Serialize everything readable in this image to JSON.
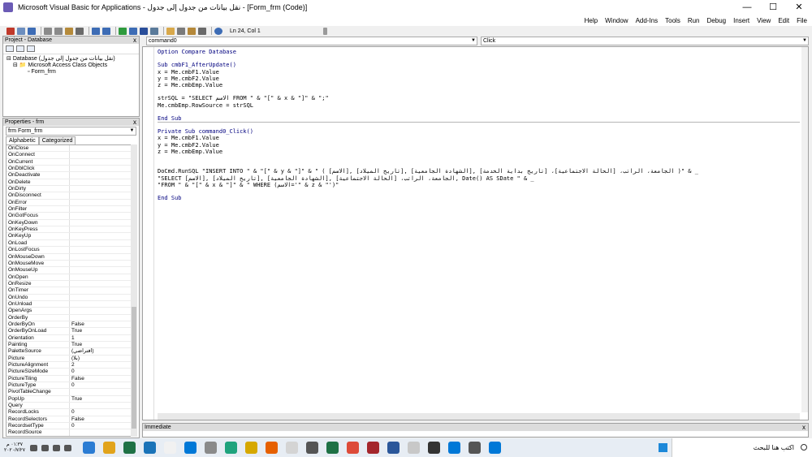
{
  "window": {
    "title": "Microsoft Visual Basic for Applications - نقل بيانات من جدول إلى جدول - [Form_frm (Code)]",
    "minimize": "—",
    "maximize": "☐",
    "close": "✕"
  },
  "menu": [
    "Help",
    "Window",
    "Add-Ins",
    "Tools",
    "Run",
    "Debug",
    "Insert",
    "View",
    "Edit",
    "File"
  ],
  "toolbar": {
    "cursor_position": "Ln 24, Col 1"
  },
  "project": {
    "title": "Project - Database",
    "close": "x",
    "root": "Database (نقل بيانات من جدول إلى جدول)",
    "folder": "Microsoft Access Class Objects",
    "item": "Form_frm"
  },
  "properties": {
    "title": "Properties - frm",
    "close": "x",
    "object": "frm Form_frm",
    "tabs": [
      "Alphabetic",
      "Categorized"
    ],
    "rows": [
      {
        "k": "OnClose",
        "v": ""
      },
      {
        "k": "OnConnect",
        "v": ""
      },
      {
        "k": "OnCurrent",
        "v": ""
      },
      {
        "k": "OnDblClick",
        "v": ""
      },
      {
        "k": "OnDeactivate",
        "v": ""
      },
      {
        "k": "OnDelete",
        "v": ""
      },
      {
        "k": "OnDirty",
        "v": ""
      },
      {
        "k": "OnDisconnect",
        "v": ""
      },
      {
        "k": "OnError",
        "v": ""
      },
      {
        "k": "OnFilter",
        "v": ""
      },
      {
        "k": "OnGotFocus",
        "v": ""
      },
      {
        "k": "OnKeyDown",
        "v": ""
      },
      {
        "k": "OnKeyPress",
        "v": ""
      },
      {
        "k": "OnKeyUp",
        "v": ""
      },
      {
        "k": "OnLoad",
        "v": ""
      },
      {
        "k": "OnLostFocus",
        "v": ""
      },
      {
        "k": "OnMouseDown",
        "v": ""
      },
      {
        "k": "OnMouseMove",
        "v": ""
      },
      {
        "k": "OnMouseUp",
        "v": ""
      },
      {
        "k": "OnOpen",
        "v": ""
      },
      {
        "k": "OnResize",
        "v": ""
      },
      {
        "k": "OnTimer",
        "v": ""
      },
      {
        "k": "OnUndo",
        "v": ""
      },
      {
        "k": "OnUnload",
        "v": ""
      },
      {
        "k": "OpenArgs",
        "v": ""
      },
      {
        "k": "OrderBy",
        "v": ""
      },
      {
        "k": "OrderByOn",
        "v": "False"
      },
      {
        "k": "OrderByOnLoad",
        "v": "True"
      },
      {
        "k": "Orientation",
        "v": "1"
      },
      {
        "k": "Painting",
        "v": "True"
      },
      {
        "k": "PaletteSource",
        "v": "(افتراضي)"
      },
      {
        "k": "Picture",
        "v": "(بلا)"
      },
      {
        "k": "PictureAlignment",
        "v": "2"
      },
      {
        "k": "PictureSizeMode",
        "v": "0"
      },
      {
        "k": "PictureTiling",
        "v": "False"
      },
      {
        "k": "PictureType",
        "v": "0"
      },
      {
        "k": "PivotTableChange",
        "v": ""
      },
      {
        "k": "PopUp",
        "v": "True"
      },
      {
        "k": "Query",
        "v": ""
      },
      {
        "k": "RecordLocks",
        "v": "0"
      },
      {
        "k": "RecordSelectors",
        "v": "False"
      },
      {
        "k": "RecordsetType",
        "v": "0"
      },
      {
        "k": "RecordSource",
        "v": ""
      }
    ]
  },
  "code_window": {
    "object_combo": "command0",
    "procedure_combo": "Click",
    "lines": [
      "Option Compare Database",
      "",
      "Sub cmbF1_AfterUpdate()",
      "x = Me.cmbF1.Value",
      "y = Me.cmbF2.Value",
      "z = Me.cmbEmp.Value",
      "",
      "strSQL = \"SELECT الاسم FROM \" & \"[\" & x & \"]\" & \";\"",
      "Me.cmbEmp.RowSource = strSQL",
      "",
      "End Sub",
      "",
      "Private Sub command0_Click()",
      "x = Me.cmbF1.Value",
      "y = Me.cmbF2.Value",
      "z = Me.cmbEmp.Value",
      "",
      "",
      "DoCmd.RunSQL \"INSERT INTO \" & \"[\" & y & \"]\" & \" ( [الاسم], [تاريخ الميلاد], [الشهادة الجامعية], الجامعة، الراتب، [الحالة الاجتماعية]، [تاريخ بداية الخدمة] )\" & _",
      "\"SELECT [الاسم], [تاريخ الميلاد], [الشهادة الجامعية], الجامعة، الراتب، [الحالة الاجتماعية], Date() AS SDate \" & _",
      "\"FROM \" & \"[\" & x & \"]\" & \" WHERE (الاسم='\" & z & \"')\"",
      "",
      "End Sub",
      ""
    ],
    "divider_after": [
      10
    ]
  },
  "immediate": {
    "title": "Immediate",
    "close": "x"
  },
  "taskbar": {
    "search_placeholder": "اكتب هنا للبحث",
    "time": "٠١:٣٧ م",
    "date": "٢٠٢٠/٧/٢٧",
    "apps": [
      "#2b7cd3",
      "#e1a31b",
      "#1e7145",
      "#1a73b8",
      "#f1f1f1",
      "#0078d7",
      "#8a8a8a",
      "#1fa37d",
      "#d6a800",
      "#e66000",
      "#d4d4d4",
      "#555555",
      "#1e7145",
      "#dd4b39",
      "#a4262c",
      "#2b579a",
      "#c8c8c8",
      "#333333",
      "#0078d7",
      "#555555",
      "#0078d7"
    ]
  }
}
